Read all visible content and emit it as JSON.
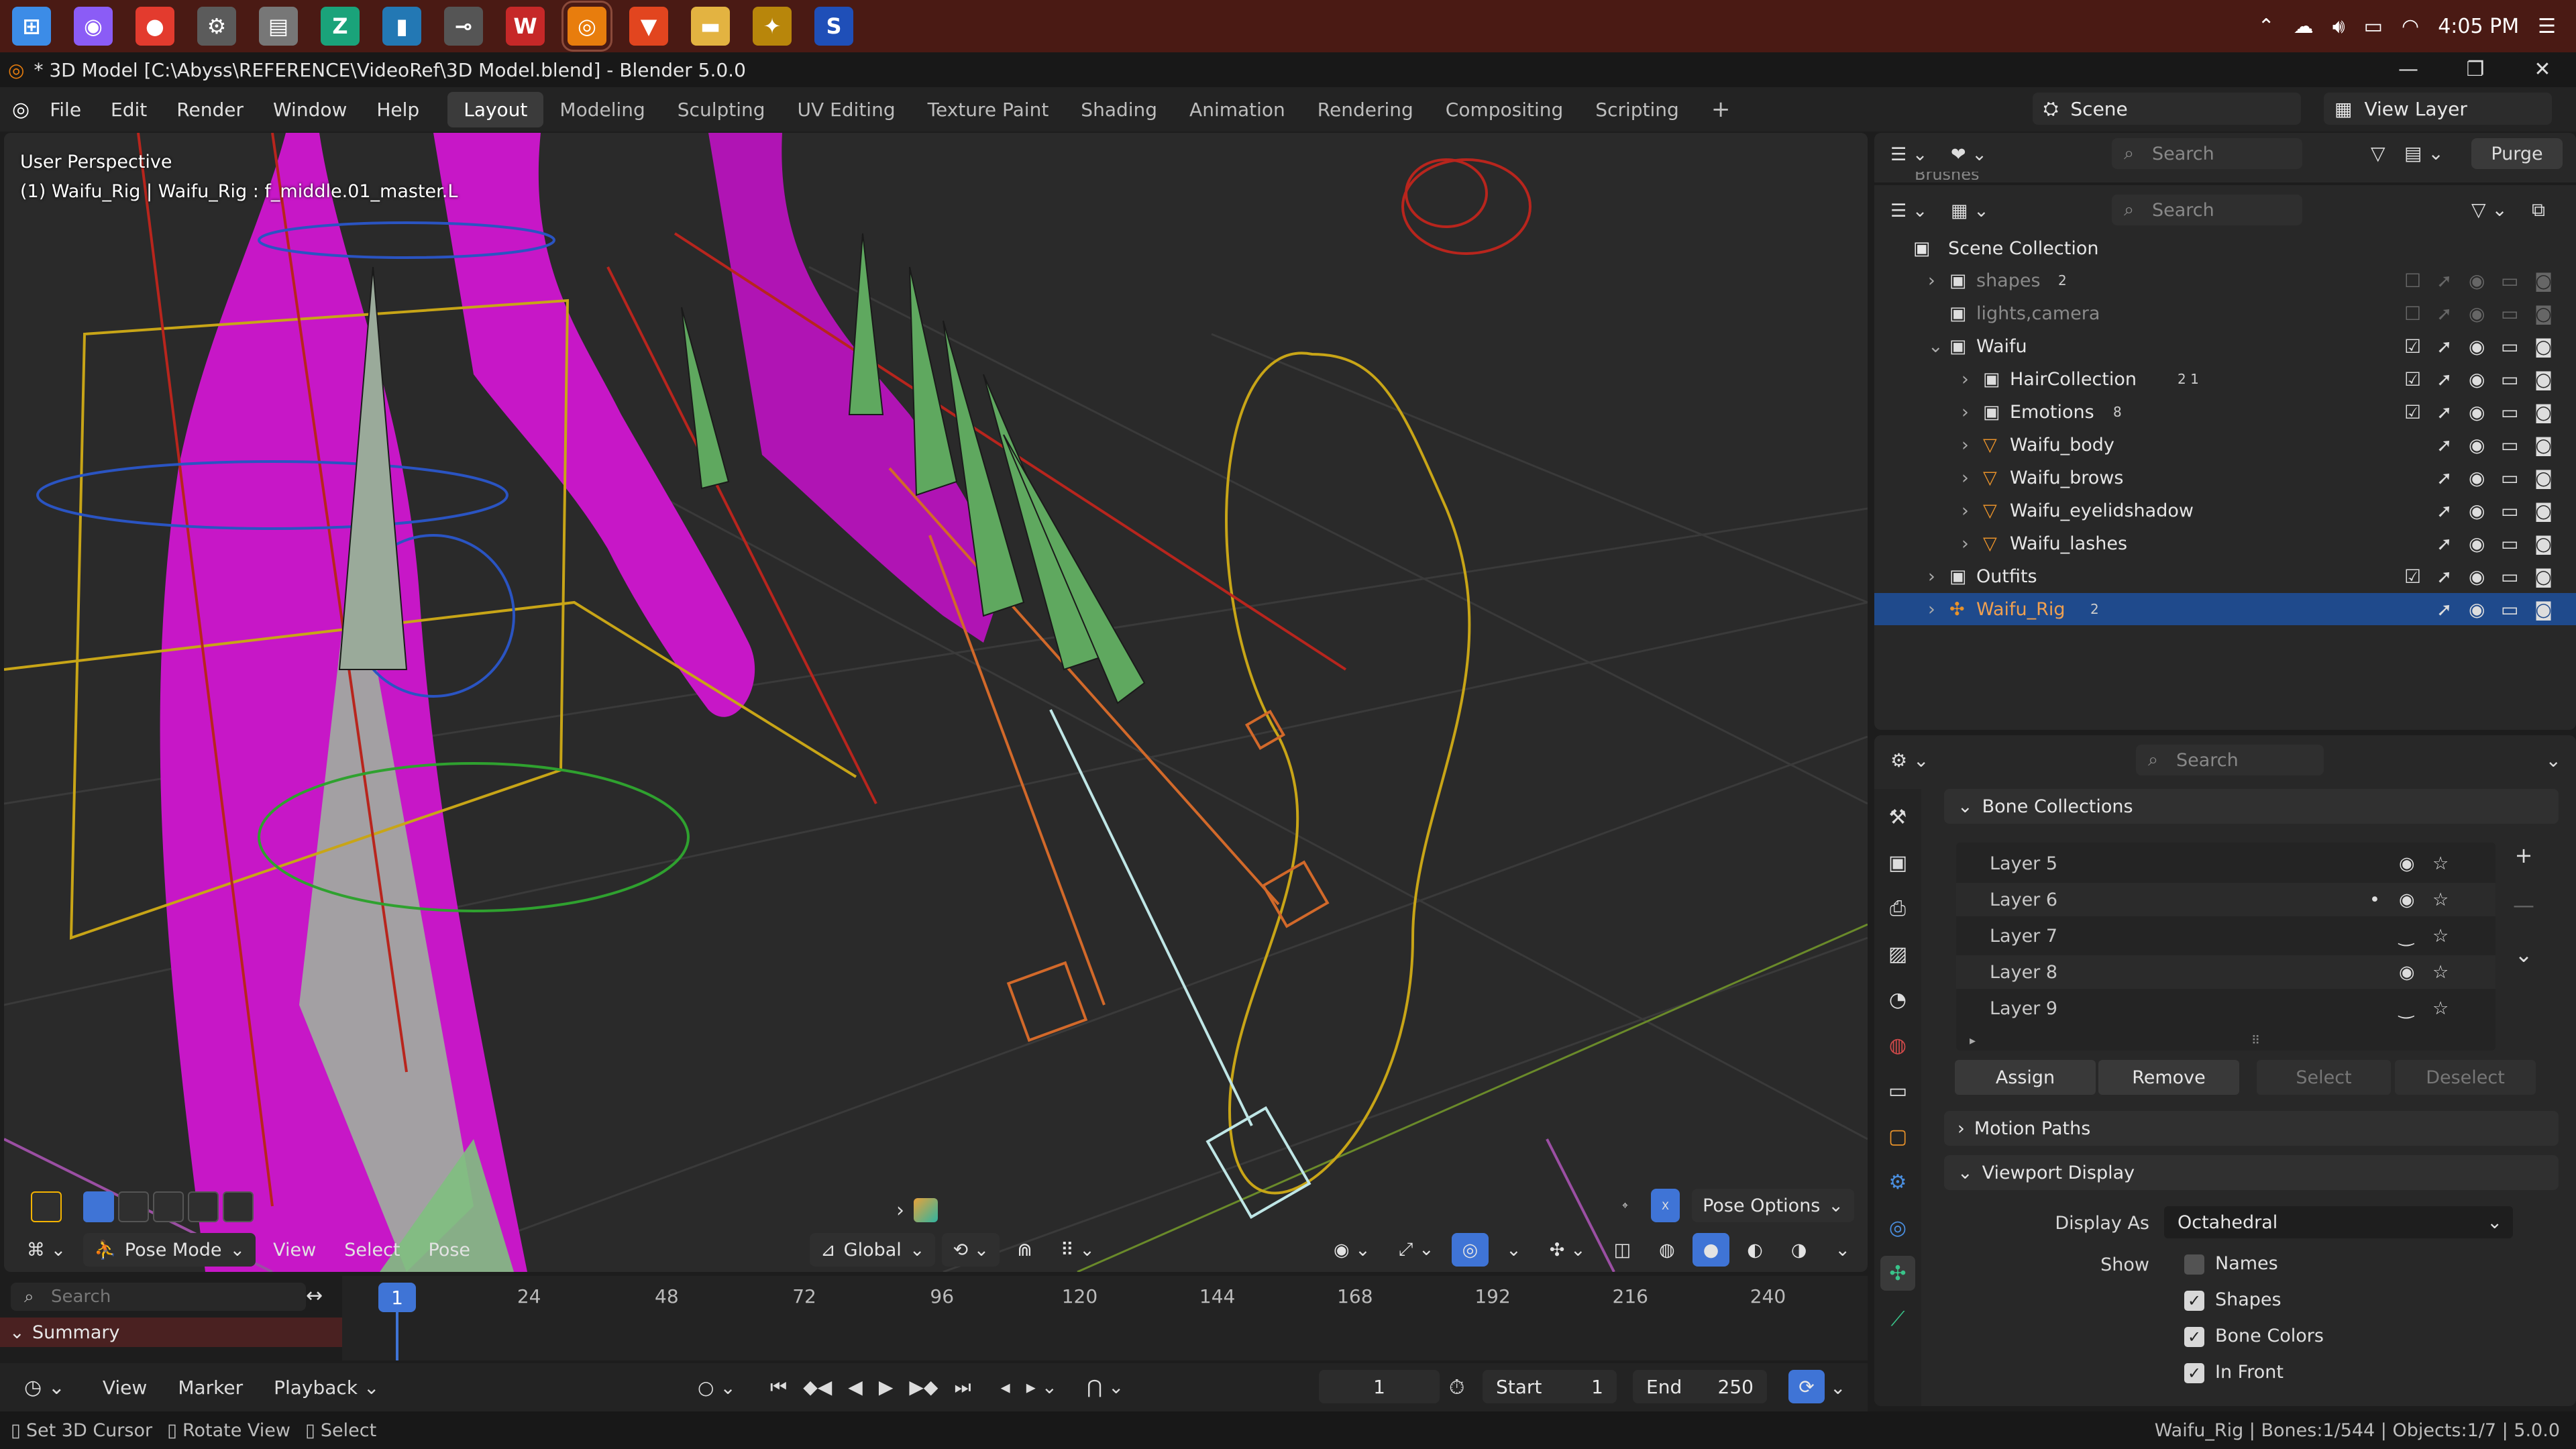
{
  "taskbar": {
    "icons": [
      {
        "name": "windows-start-icon",
        "glyph": "⊞",
        "color": "#3c8ce7"
      },
      {
        "name": "photos-app-icon",
        "glyph": "◉",
        "color": "#8b5cf6"
      },
      {
        "name": "chrome-icon",
        "glyph": "●",
        "color": "#e33b2e"
      },
      {
        "name": "settings-icon",
        "glyph": "⚙",
        "color": "#5b5b5b"
      },
      {
        "name": "file-app-icon",
        "glyph": "▤",
        "color": "#777"
      },
      {
        "name": "affinity-icon",
        "glyph": "Z",
        "color": "#1aa37a"
      },
      {
        "name": "app-blue-icon",
        "glyph": "▮",
        "color": "#2378b4"
      },
      {
        "name": "app-mouse-icon",
        "glyph": "⊸",
        "color": "#555"
      },
      {
        "name": "wps-icon",
        "glyph": "W",
        "color": "#c62828"
      },
      {
        "name": "blender-taskbar-icon",
        "glyph": "◎",
        "color": "#e87d0d"
      },
      {
        "name": "brave-icon",
        "glyph": "▼",
        "color": "#e2451f"
      },
      {
        "name": "file-explorer-icon",
        "glyph": "▬",
        "color": "#e3b341"
      },
      {
        "name": "app-gold-icon",
        "glyph": "✦",
        "color": "#b8860b"
      },
      {
        "name": "app-s-icon",
        "glyph": "S",
        "color": "#1f4fb8"
      }
    ],
    "time": "4:05 PM"
  },
  "title": "* 3D Model [C:\\Abyss\\REFERENCE\\VideoRef\\3D Model.blend] - Blender 5.0.0",
  "menu": [
    "File",
    "Edit",
    "Render",
    "Window",
    "Help"
  ],
  "workspaces": [
    "Layout",
    "Modeling",
    "Sculpting",
    "UV Editing",
    "Texture Paint",
    "Shading",
    "Animation",
    "Rendering",
    "Compositing",
    "Scripting"
  ],
  "active_workspace": "Layout",
  "scene": "Scene",
  "view_layer": "View Layer",
  "viewport": {
    "perspective": "User Perspective",
    "active": "(1) Waifu_Rig | Waifu_Rig : f_middle.01_master.L",
    "mode": "Pose Mode",
    "menus": [
      "View",
      "Select",
      "Pose"
    ],
    "orientation": "Global",
    "pose_options": "Pose Options"
  },
  "outliner": {
    "search_placeholder": "Search",
    "purge": "Purge",
    "brushes_partial": "Brushes",
    "scene_collection": "Scene Collection",
    "rows": [
      {
        "label": "shapes",
        "badge": "2",
        "dim": true
      },
      {
        "label": "lights,camera",
        "badge": "",
        "dim": true
      },
      {
        "label": "Waifu",
        "badge": "",
        "dim": false
      },
      {
        "label": "HairCollection",
        "badge": "2  1",
        "dim": false
      },
      {
        "label": "Emotions",
        "badge": "8",
        "dim": false
      },
      {
        "label": "Waifu_body",
        "badge": "",
        "dim": false
      },
      {
        "label": "Waifu_brows",
        "badge": "",
        "dim": false
      },
      {
        "label": "Waifu_eyelidshadow",
        "badge": "",
        "dim": false
      },
      {
        "label": "Waifu_lashes",
        "badge": "",
        "dim": false
      },
      {
        "label": "Outfits",
        "badge": "",
        "dim": false
      },
      {
        "label": "Waifu_Rig",
        "badge": "2",
        "dim": false
      }
    ]
  },
  "properties": {
    "search_placeholder": "Search",
    "bone_collections": "Bone Collections",
    "layers": [
      "Layer 5",
      "Layer 6",
      "Layer 7",
      "Layer 8",
      "Layer 9"
    ],
    "assign": "Assign",
    "remove": "Remove",
    "select": "Select",
    "deselect": "Deselect",
    "motion_paths": "Motion Paths",
    "viewport_display": "Viewport Display",
    "display_as_label": "Display As",
    "display_as_value": "Octahedral",
    "show_label": "Show",
    "names": "Names",
    "shapes": "Shapes",
    "bone_colors": "Bone Colors",
    "in_front": "In Front"
  },
  "timeline": {
    "search_placeholder": "Search",
    "summary": "Summary",
    "ticks": [
      "24",
      "48",
      "72",
      "96",
      "120",
      "144",
      "168",
      "192",
      "216",
      "240"
    ],
    "current_frame": "1",
    "menus": [
      "View",
      "Marker",
      "Playback"
    ],
    "frame_field": "1",
    "start_label": "Start",
    "start_value": "1",
    "end_label": "End",
    "end_value": "250"
  },
  "status": {
    "hint1": "Set 3D Cursor",
    "hint2": "Rotate View",
    "hint3": "Select",
    "right": "Waifu_Rig | Bones:1/544 | Objects:1/7 | 5.0.0"
  }
}
